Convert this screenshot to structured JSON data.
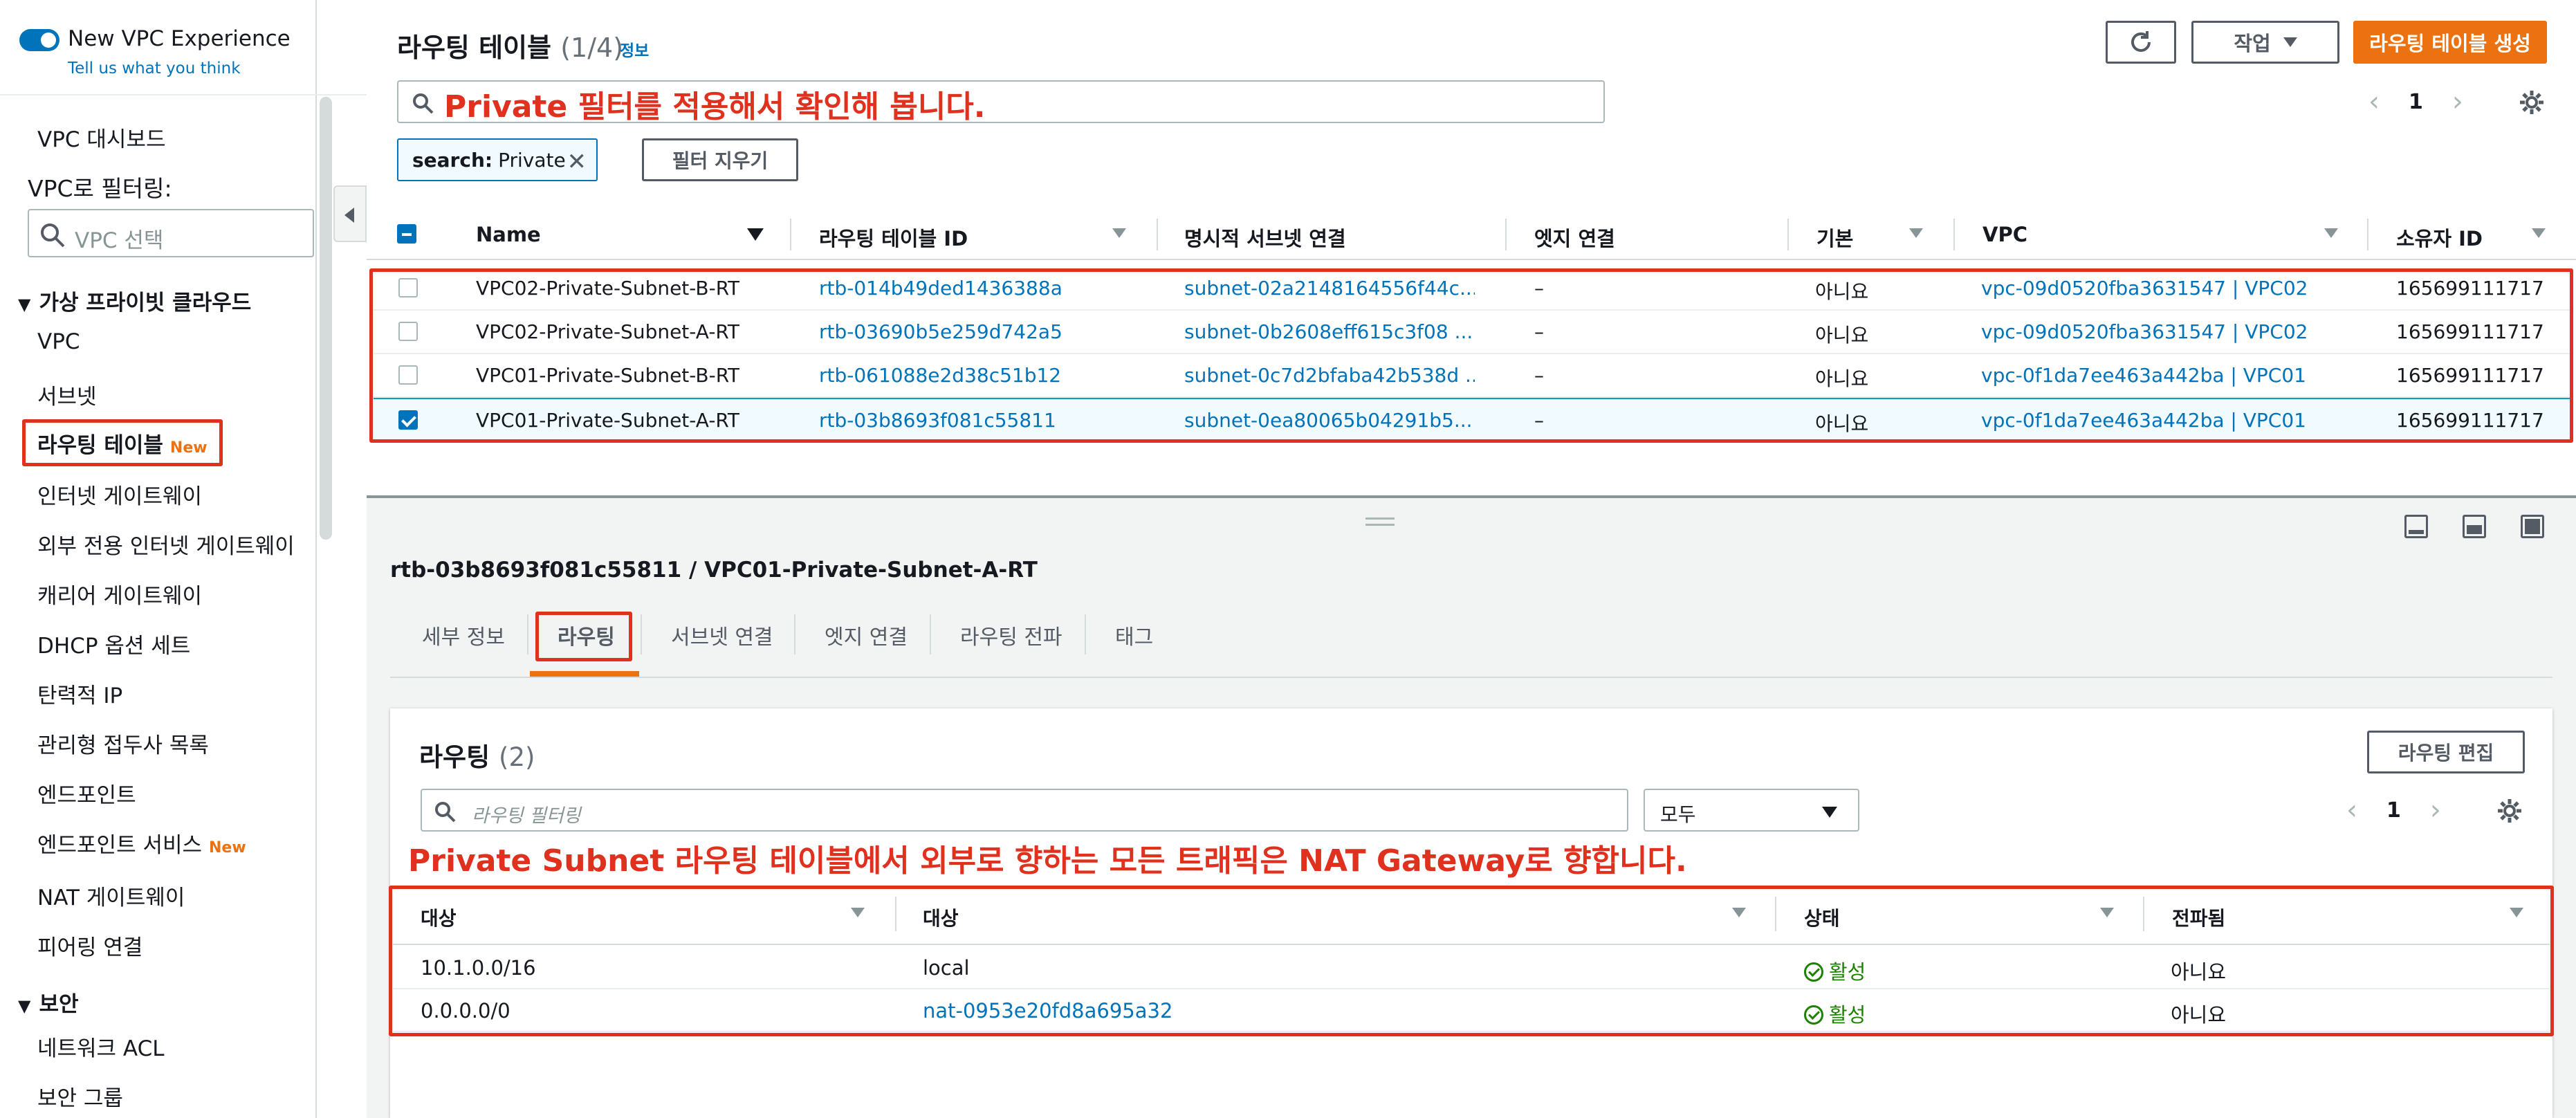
{
  "sidebar": {
    "experience_label": "New VPC Experience",
    "feedback_link": "Tell us what you think",
    "dashboard": "VPC 대시보드",
    "filter_label": "VPC로 필터링:",
    "vpc_select_placeholder": "VPC 선택",
    "section_vpc": "가상 프라이빗 클라우드",
    "items": [
      {
        "label": "VPC"
      },
      {
        "label": "서브넷"
      },
      {
        "label": "라우팅 테이블",
        "badge": "New"
      },
      {
        "label": "인터넷 게이트웨이"
      },
      {
        "label": "외부 전용 인터넷 게이트웨이"
      },
      {
        "label": "캐리어 게이트웨이"
      },
      {
        "label": "DHCP 옵션 세트"
      },
      {
        "label": "탄력적 IP"
      },
      {
        "label": "관리형 접두사 목록"
      },
      {
        "label": "엔드포인트"
      },
      {
        "label": "엔드포인트 서비스",
        "badge": "New"
      },
      {
        "label": "NAT 게이트웨이"
      },
      {
        "label": "피어링 연결"
      }
    ],
    "section_security": "보안",
    "security_items": [
      {
        "label": "네트워크 ACL"
      },
      {
        "label": "보안 그룹"
      }
    ]
  },
  "header": {
    "title": "라우팅 테이블",
    "count": "(1/4)",
    "info": "정보",
    "action_button": "작업",
    "create_button": "라우팅 테이블 생성",
    "search_value": "Private 필터를 적용해서 확인해 봅니다.",
    "page": "1",
    "filter_token_key": "search:",
    "filter_token_value": "Private",
    "clear_filter": "필터 지우기"
  },
  "table": {
    "columns": [
      "Name",
      "라우팅 테이블 ID",
      "명시적 서브넷 연결",
      "엣지 연결",
      "기본",
      "VPC",
      "소유자 ID"
    ],
    "rows": [
      {
        "name": "VPC02-Private-Subnet-B-RT",
        "id": "rtb-014b49ded1436388a",
        "subnet": "subnet-02a2148164556f44c...",
        "edge": "–",
        "main": "아니요",
        "vpc": "vpc-09d0520fba3631547 | VPC02",
        "owner": "165699111717",
        "selected": false
      },
      {
        "name": "VPC02-Private-Subnet-A-RT",
        "id": "rtb-03690b5e259d742a5",
        "subnet": "subnet-0b2608eff615c3f08 ...",
        "edge": "–",
        "main": "아니요",
        "vpc": "vpc-09d0520fba3631547 | VPC02",
        "owner": "165699111717",
        "selected": false
      },
      {
        "name": "VPC01-Private-Subnet-B-RT",
        "id": "rtb-061088e2d38c51b12",
        "subnet": "subnet-0c7d2bfaba42b538d ...",
        "edge": "–",
        "main": "아니요",
        "vpc": "vpc-0f1da7ee463a442ba | VPC01",
        "owner": "165699111717",
        "selected": false
      },
      {
        "name": "VPC01-Private-Subnet-A-RT",
        "id": "rtb-03b8693f081c55811",
        "subnet": "subnet-0ea80065b04291b5...",
        "edge": "–",
        "main": "아니요",
        "vpc": "vpc-0f1da7ee463a442ba | VPC01",
        "owner": "165699111717",
        "selected": true
      }
    ]
  },
  "detail": {
    "title": "rtb-03b8693f081c55811 / VPC01-Private-Subnet-A-RT",
    "tabs": [
      "세부 정보",
      "라우팅",
      "서브넷 연결",
      "엣지 연결",
      "라우팅 전파",
      "태그"
    ],
    "routes_title": "라우팅",
    "routes_count": "(2)",
    "edit_button": "라우팅 편집",
    "filter_placeholder": "라우팅 필터링",
    "select_value": "모두",
    "page": "1",
    "annotation": "Private Subnet 라우팅 테이블에서 외부로 향하는 모든 트래픽은 NAT Gateway로 향합니다.",
    "columns": [
      "대상",
      "대상",
      "상태",
      "전파됨"
    ],
    "routes": [
      {
        "destination": "10.1.0.0/16",
        "target": "local",
        "target_link": false,
        "status": "활성",
        "propagated": "아니요"
      },
      {
        "destination": "0.0.0.0/0",
        "target": "nat-0953e20fd8a695a32",
        "target_link": true,
        "status": "활성",
        "propagated": "아니요"
      }
    ]
  },
  "colors": {
    "accent": "#ec7211",
    "link": "#0073bb",
    "annotation": "#e0301e",
    "success": "#1d8102"
  }
}
